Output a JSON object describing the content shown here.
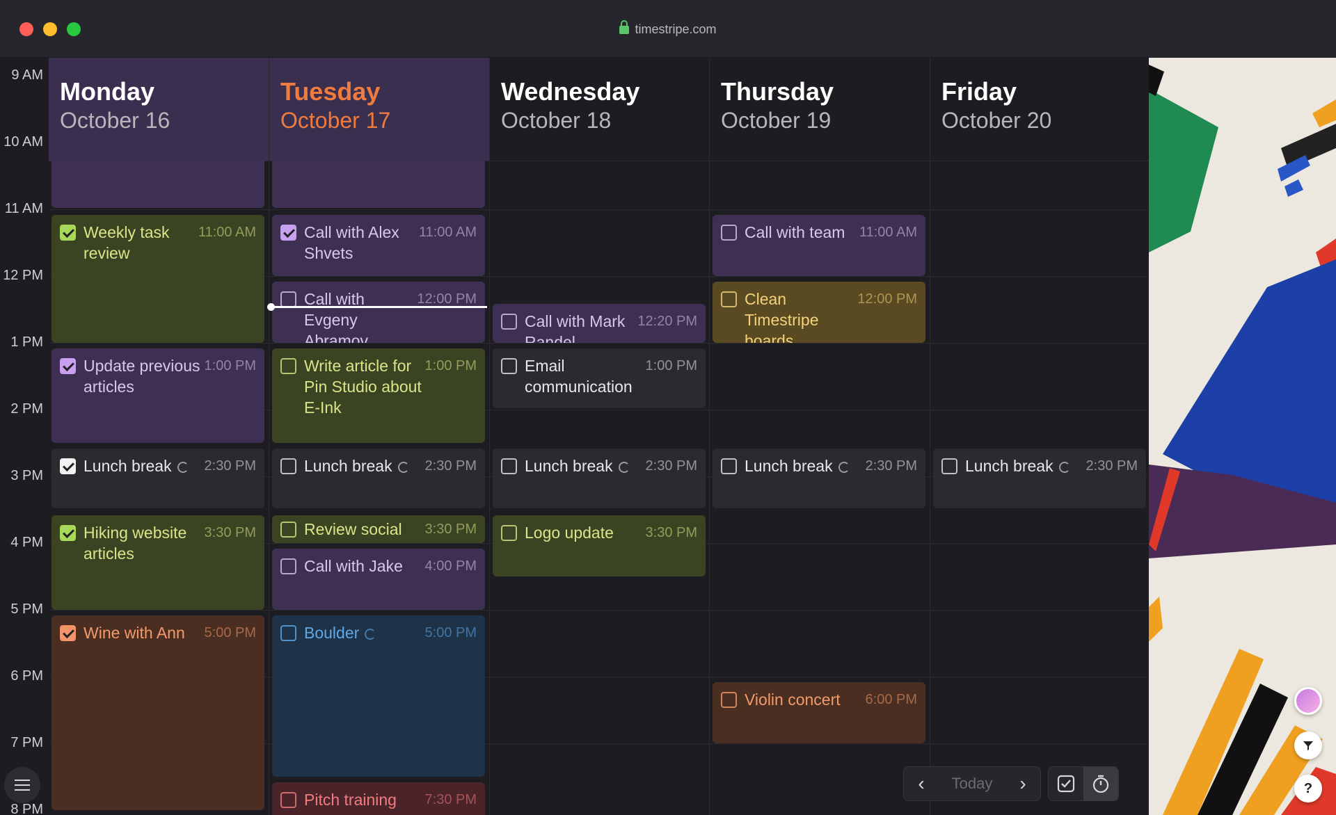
{
  "browser": {
    "url": "timestripe.com"
  },
  "time_labels": [
    "9 AM",
    "10 AM",
    "11 AM",
    "12 PM",
    "1 PM",
    "2 PM",
    "3 PM",
    "4 PM",
    "5 PM",
    "6 PM",
    "7 PM",
    "8 PM"
  ],
  "days": [
    {
      "name": "Monday",
      "date": "October 16"
    },
    {
      "name": "Tuesday",
      "date": "October 17"
    },
    {
      "name": "Wednesday",
      "date": "October 18"
    },
    {
      "name": "Thursday",
      "date": "October 19"
    },
    {
      "name": "Friday",
      "date": "October 20"
    }
  ],
  "events": {
    "mon_weekly": {
      "title": "Weekly task review",
      "time": "11:00 AM",
      "done": true
    },
    "mon_update": {
      "title": "Update previous articles",
      "time": "1:00 PM",
      "done": true
    },
    "mon_lunch": {
      "title": "Lunch break",
      "time": "2:30 PM",
      "done": true
    },
    "mon_hiking": {
      "title": "Hiking website articles",
      "time": "3:30 PM",
      "done": true
    },
    "mon_wine": {
      "title": "Wine with Ann",
      "time": "5:00 PM",
      "done": true
    },
    "tue_alex": {
      "title": "Call with Alex Shvets",
      "time": "11:00 AM",
      "done": true
    },
    "tue_evgeny": {
      "title": "Call with Evgeny Abramov",
      "time": "12:00 PM",
      "done": false
    },
    "tue_article": {
      "title": "Write article for Pin Studio about E-Ink",
      "time": "1:00 PM",
      "done": false
    },
    "tue_lunch": {
      "title": "Lunch break",
      "time": "2:30 PM",
      "done": false
    },
    "tue_social": {
      "title": "Review social",
      "time": "3:30 PM",
      "done": false
    },
    "tue_jake": {
      "title": "Call with Jake",
      "time": "4:00 PM",
      "done": false
    },
    "tue_boulder": {
      "title": "Boulder",
      "time": "5:00 PM",
      "done": false
    },
    "tue_pitch": {
      "title": "Pitch training",
      "time": "7:30 PM",
      "done": false
    },
    "wed_mark": {
      "title": "Call with Mark Randel",
      "time": "12:20 PM",
      "done": false
    },
    "wed_email": {
      "title": "Email communication",
      "time": "1:00 PM",
      "done": false
    },
    "wed_lunch": {
      "title": "Lunch break",
      "time": "2:30 PM",
      "done": false
    },
    "wed_logo": {
      "title": "Logo update",
      "time": "3:30 PM",
      "done": false
    },
    "thu_team": {
      "title": "Call with team",
      "time": "11:00 AM",
      "done": false
    },
    "thu_clean": {
      "title": "Clean Timestripe boards",
      "time": "12:00 PM",
      "done": false
    },
    "thu_lunch": {
      "title": "Lunch break",
      "time": "2:30 PM",
      "done": false
    },
    "thu_violin": {
      "title": "Violin concert",
      "time": "6:00 PM",
      "done": false
    },
    "fri_lunch": {
      "title": "Lunch break",
      "time": "2:30 PM",
      "done": false
    }
  },
  "bottom_nav": {
    "today_label": "Today",
    "prev_icon": "chevron-left-icon",
    "next_icon": "chevron-right-icon",
    "tasks_icon": "checkbox-icon",
    "timer_icon": "timer-icon"
  },
  "fabs": {
    "help_label": "?"
  },
  "colors": {
    "today_accent": "#f07b3f",
    "purple_event": "#3d3052",
    "green_event": "#3a4322",
    "orange_event": "#4a2e22",
    "blue_event": "#1f3348",
    "yellow_event": "#5a4a22"
  }
}
